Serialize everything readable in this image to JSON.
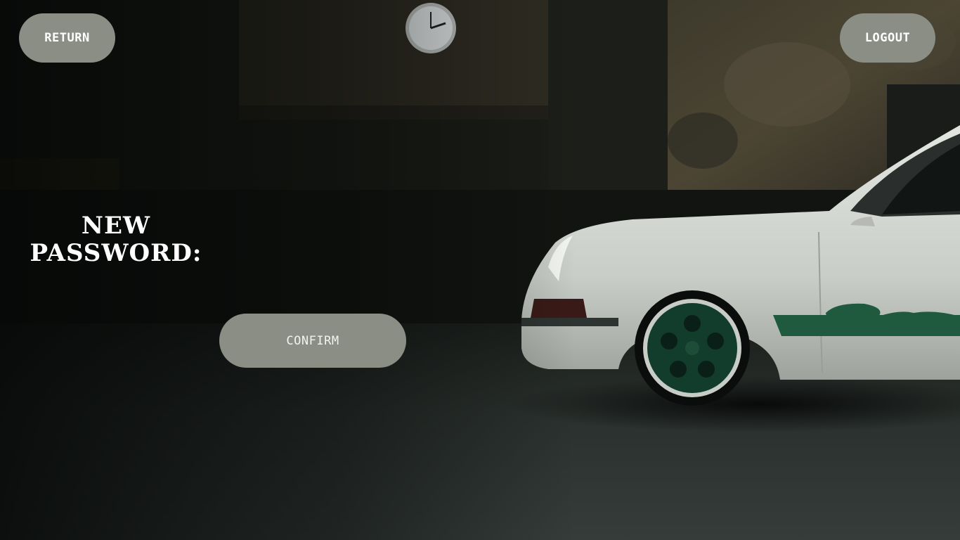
{
  "header": {
    "return_label": "RETURN",
    "logout_label": "LOGOUT"
  },
  "form": {
    "label": "NEW\nPASSWORD:",
    "password_value": "",
    "confirm_label": "CONFIRM"
  },
  "colors": {
    "button_bg": "#8b8e85",
    "button_text": "#ffffff",
    "car_body": "#d7dad5",
    "car_stripe": "#1f5a3e"
  },
  "icons": {
    "background": "garage-scene-with-white-sports-car",
    "clock": "wall-clock-icon"
  }
}
